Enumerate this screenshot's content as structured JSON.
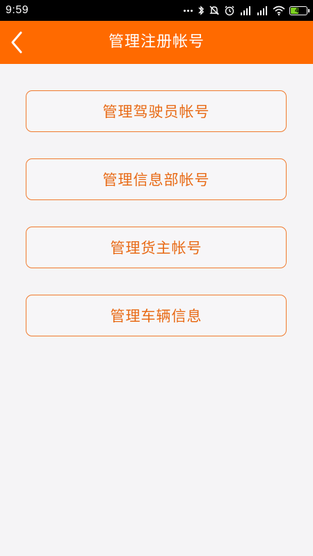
{
  "status_bar": {
    "time": "9:59",
    "battery_level": "45",
    "icons": [
      "more-dots-icon",
      "bluetooth-icon",
      "alarm-off-icon",
      "alarm-clock-icon",
      "hd-signal-icon",
      "signal-icon",
      "wifi-icon",
      "battery-icon"
    ]
  },
  "header": {
    "title": "管理注册帐号",
    "back_icon": "chevron-left-icon"
  },
  "menu": {
    "items": [
      {
        "label": "管理驾驶员帐号"
      },
      {
        "label": "管理信息部帐号"
      },
      {
        "label": "管理货主帐号"
      },
      {
        "label": "管理车辆信息"
      }
    ]
  },
  "colors": {
    "accent": "#ff6a00",
    "button_border": "#f07a2c",
    "button_text": "#e86a15",
    "background": "#f5f4f6",
    "status_bar": "#000000"
  }
}
